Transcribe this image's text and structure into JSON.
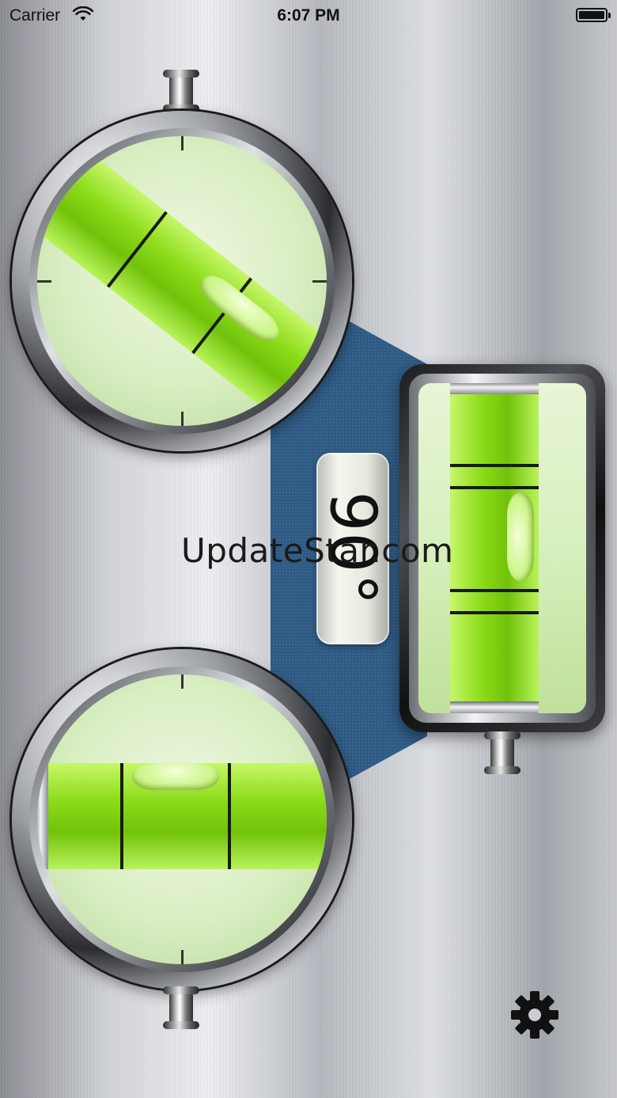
{
  "status_bar": {
    "carrier": "Carrier",
    "time": "6:07 PM",
    "wifi_icon": "wifi-icon",
    "battery_icon": "battery-full-icon"
  },
  "level": {
    "angle_readout": "90°",
    "top_circle_vial": "tilted-diagonal",
    "bottom_circle_vial": "horizontal-centered",
    "right_rect_vial": "vertical-centered"
  },
  "watermark": "UpdateStar.com",
  "settings": {
    "icon": "gear-icon"
  },
  "colors": {
    "vial_green": "#8ddc1a",
    "connector_blue": "#2f5a83",
    "ink": "#111111"
  }
}
